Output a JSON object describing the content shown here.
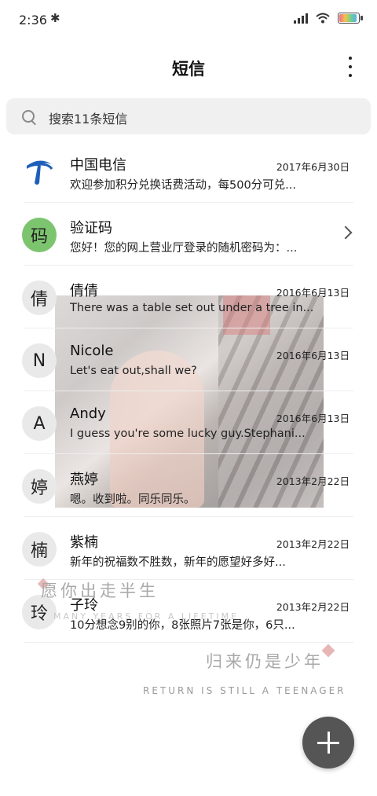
{
  "status": {
    "time": "2:36"
  },
  "header": {
    "title": "短信"
  },
  "search": {
    "placeholder": "搜索11条短信"
  },
  "conversations": [
    {
      "name": "中国电信",
      "date": "2017年6月30日",
      "preview": "欢迎参加积分兑换话费活动，每500分可兑..."
    },
    {
      "name": "验证码",
      "avatar": "码",
      "preview": "您好！您的网上营业厅登录的随机密码为：..."
    },
    {
      "name": "倩倩",
      "avatar": "倩",
      "date": "2016年6月13日",
      "preview": "There was a table set out under a tree in..."
    },
    {
      "name": "Nicole",
      "avatar": "N",
      "date": "2016年6月13日",
      "preview": "Let's eat out,shall we?"
    },
    {
      "name": "Andy",
      "avatar": "A",
      "date": "2016年6月13日",
      "preview": "I guess you're some lucky guy.Stephani..."
    },
    {
      "name": "燕婷",
      "avatar": "婷",
      "date": "2013年2月22日",
      "preview": "嗯。收到啦。同乐同乐。"
    },
    {
      "name": "紫楠",
      "avatar": "楠",
      "date": "2013年2月22日",
      "preview": "新年的祝福数不胜数，新年的愿望好多好..."
    },
    {
      "name": "子玲",
      "avatar": "玲",
      "date": "2013年2月22日",
      "preview": "10分想念9别的你，8张照片7张是你，6只..."
    }
  ],
  "wallpaper_text": {
    "line1": "愿你出走半生",
    "line2": "MANY YEARS FOR A LIFETIME",
    "line3": "归来仍是少年",
    "line4": "RETURN IS STILL A TEENAGER"
  },
  "colors": {
    "accent_green": "#7cc56e",
    "fab": "#555555",
    "telecom_blue": "#1d5fb8"
  },
  "icons": {
    "search": "search-icon",
    "more": "more-vertical-icon",
    "compose": "plus-icon",
    "chevron": "chevron-right-icon"
  }
}
